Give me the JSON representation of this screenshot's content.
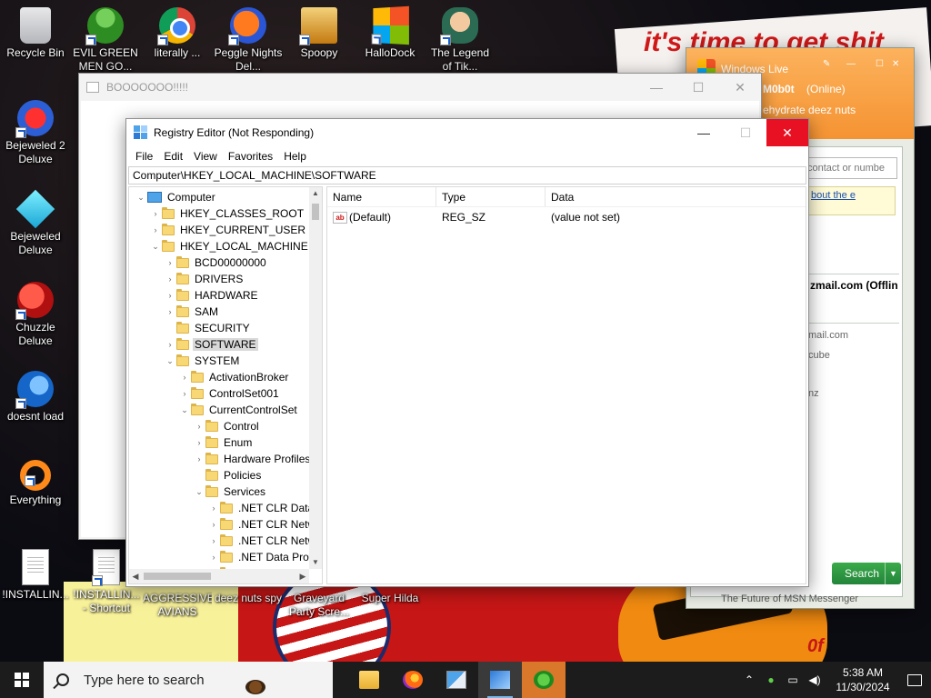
{
  "wallpaper": {
    "slogan": "it's time to get shit"
  },
  "desktop_icons": [
    {
      "label": "Recycle Bin"
    },
    {
      "label": "EVIL GREEN MEN GO..."
    },
    {
      "label": "literally ..."
    },
    {
      "label": "Peggle Nights Del..."
    },
    {
      "label": "Spoopy"
    },
    {
      "label": "HalloDock"
    },
    {
      "label": "The Legend of Tik..."
    },
    {
      "label": "Bejeweled 2 Deluxe"
    },
    {
      "label": "Bejeweled Deluxe"
    },
    {
      "label": "Chuzzle Deluxe"
    },
    {
      "label": "doesnt load"
    },
    {
      "label": "Everything"
    },
    {
      "label": "!INSTALLIN..."
    },
    {
      "label": "!INSTALLIN... - Shortcut"
    },
    {
      "label": "AGGRESSIVE AVIANS"
    },
    {
      "label": "deez nuts spy"
    },
    {
      "label": "Graveyard Party Scre..."
    },
    {
      "label": "Super Hilda"
    }
  ],
  "boo_window": {
    "title": "BOOOOOOO!!!!!"
  },
  "registry": {
    "title": "Registry Editor (Not Responding)",
    "menu": [
      "File",
      "Edit",
      "View",
      "Favorites",
      "Help"
    ],
    "address": "Computer\\HKEY_LOCAL_MACHINE\\SOFTWARE",
    "tree": [
      {
        "label": "Computer",
        "chev": "v"
      },
      {
        "label": "HKEY_CLASSES_ROOT",
        "chev": ">"
      },
      {
        "label": "HKEY_CURRENT_USER",
        "chev": ">"
      },
      {
        "label": "HKEY_LOCAL_MACHINE",
        "chev": "v"
      },
      {
        "label": "BCD00000000",
        "chev": ">"
      },
      {
        "label": "DRIVERS",
        "chev": ">"
      },
      {
        "label": "HARDWARE",
        "chev": ">"
      },
      {
        "label": "SAM",
        "chev": ">"
      },
      {
        "label": "SECURITY",
        "chev": ""
      },
      {
        "label": "SOFTWARE",
        "chev": ">"
      },
      {
        "label": "SYSTEM",
        "chev": "v"
      },
      {
        "label": "ActivationBroker",
        "chev": ">"
      },
      {
        "label": "ControlSet001",
        "chev": ">"
      },
      {
        "label": "CurrentControlSet",
        "chev": "v"
      },
      {
        "label": "Control",
        "chev": ">"
      },
      {
        "label": "Enum",
        "chev": ">"
      },
      {
        "label": "Hardware Profiles",
        "chev": ">"
      },
      {
        "label": "Policies",
        "chev": ""
      },
      {
        "label": "Services",
        "chev": "v"
      },
      {
        "label": ".NET CLR Data",
        "chev": ">"
      },
      {
        "label": ".NET CLR Netw",
        "chev": ">"
      },
      {
        "label": ".NET CLR Netw",
        "chev": ">"
      },
      {
        "label": ".NET Data Prov",
        "chev": ">"
      },
      {
        "label": ".NET Data Prov",
        "chev": ">"
      }
    ],
    "columns": [
      "Name",
      "Type",
      "Data"
    ],
    "rows": [
      {
        "name": "(Default)",
        "type": "REG_SZ",
        "data": "(value not set)"
      }
    ]
  },
  "messenger": {
    "title": "Windows Live",
    "username": "M0b0t",
    "status": "(Online)",
    "personal_message": "ehydrate deez nuts",
    "search_placeholder": "contact or numbe",
    "link_text": "bout the e",
    "contact_email": "zmail.com  (Offlin",
    "contact_email2": "mail.com",
    "contact_cube": "cube",
    "contact_nz": "nz",
    "search_button": "Search",
    "footer": "The Future of MSN Messenger"
  },
  "taskbar": {
    "search_placeholder": "Type here to search",
    "time": "5:38 AM",
    "date": "11/30/2024",
    "apps": [
      {
        "name": "file-explorer"
      },
      {
        "name": "firefox"
      },
      {
        "name": "registry-editor"
      },
      {
        "name": "app-blue"
      },
      {
        "name": "messenger"
      }
    ]
  }
}
